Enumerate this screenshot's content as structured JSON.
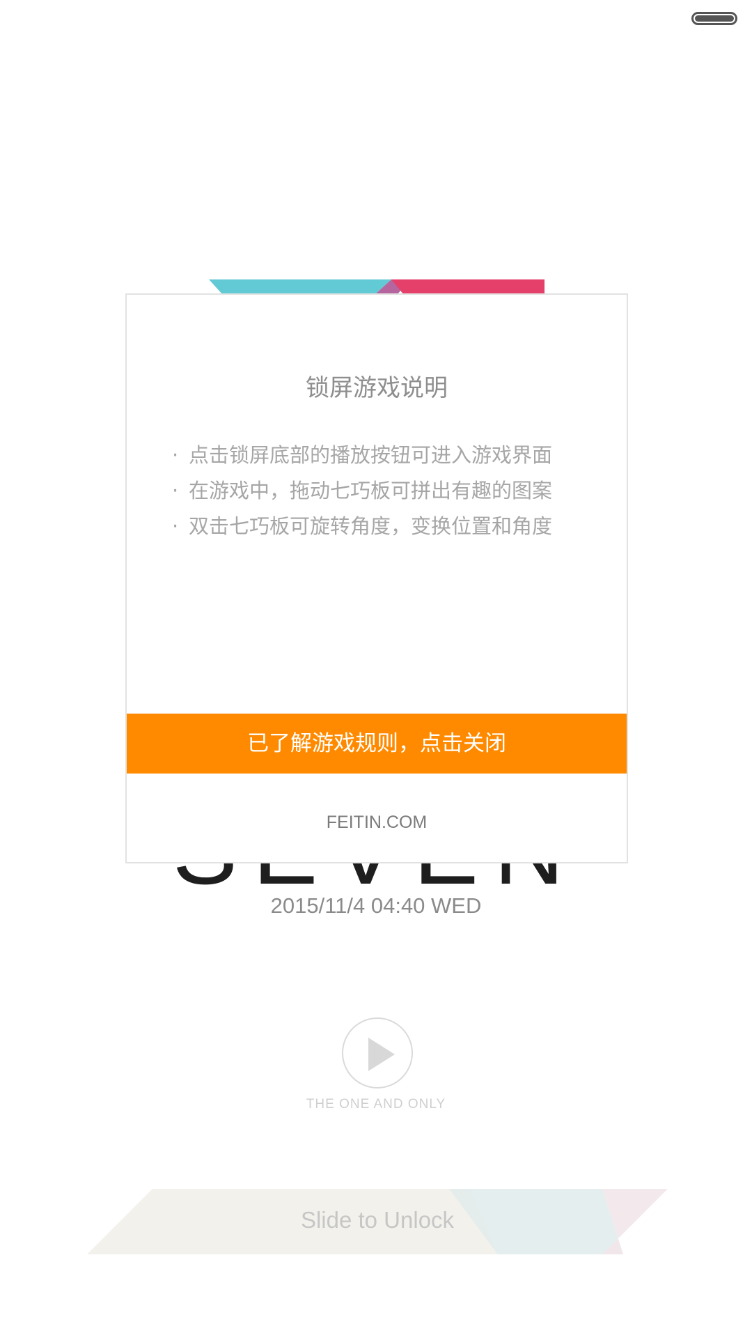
{
  "status_bar": {
    "battery_icon": "battery-icon"
  },
  "lockscreen": {
    "logo_text": "SEVEN",
    "datetime": "2015/11/4 04:40 WED",
    "play_icon": "play-icon",
    "tagline": "THE ONE AND ONLY",
    "slider_label": "Slide to Unlock"
  },
  "dialog": {
    "title": "锁屏游戏说明",
    "bullet": "·",
    "instructions": [
      "点击锁屏底部的播放按钮可进入游戏界面",
      "在游戏中，拖动七巧板可拼出有趣的图案",
      "双击七巧板可旋转角度，变换位置和角度"
    ],
    "close_label": "已了解游戏规则，点击关闭",
    "credit": "FEITIN.COM"
  },
  "colors": {
    "accent_orange": "#ff8a00",
    "stripe_teal": "#62cad4",
    "stripe_purple": "#b5669e",
    "stripe_red": "#e5406a"
  }
}
